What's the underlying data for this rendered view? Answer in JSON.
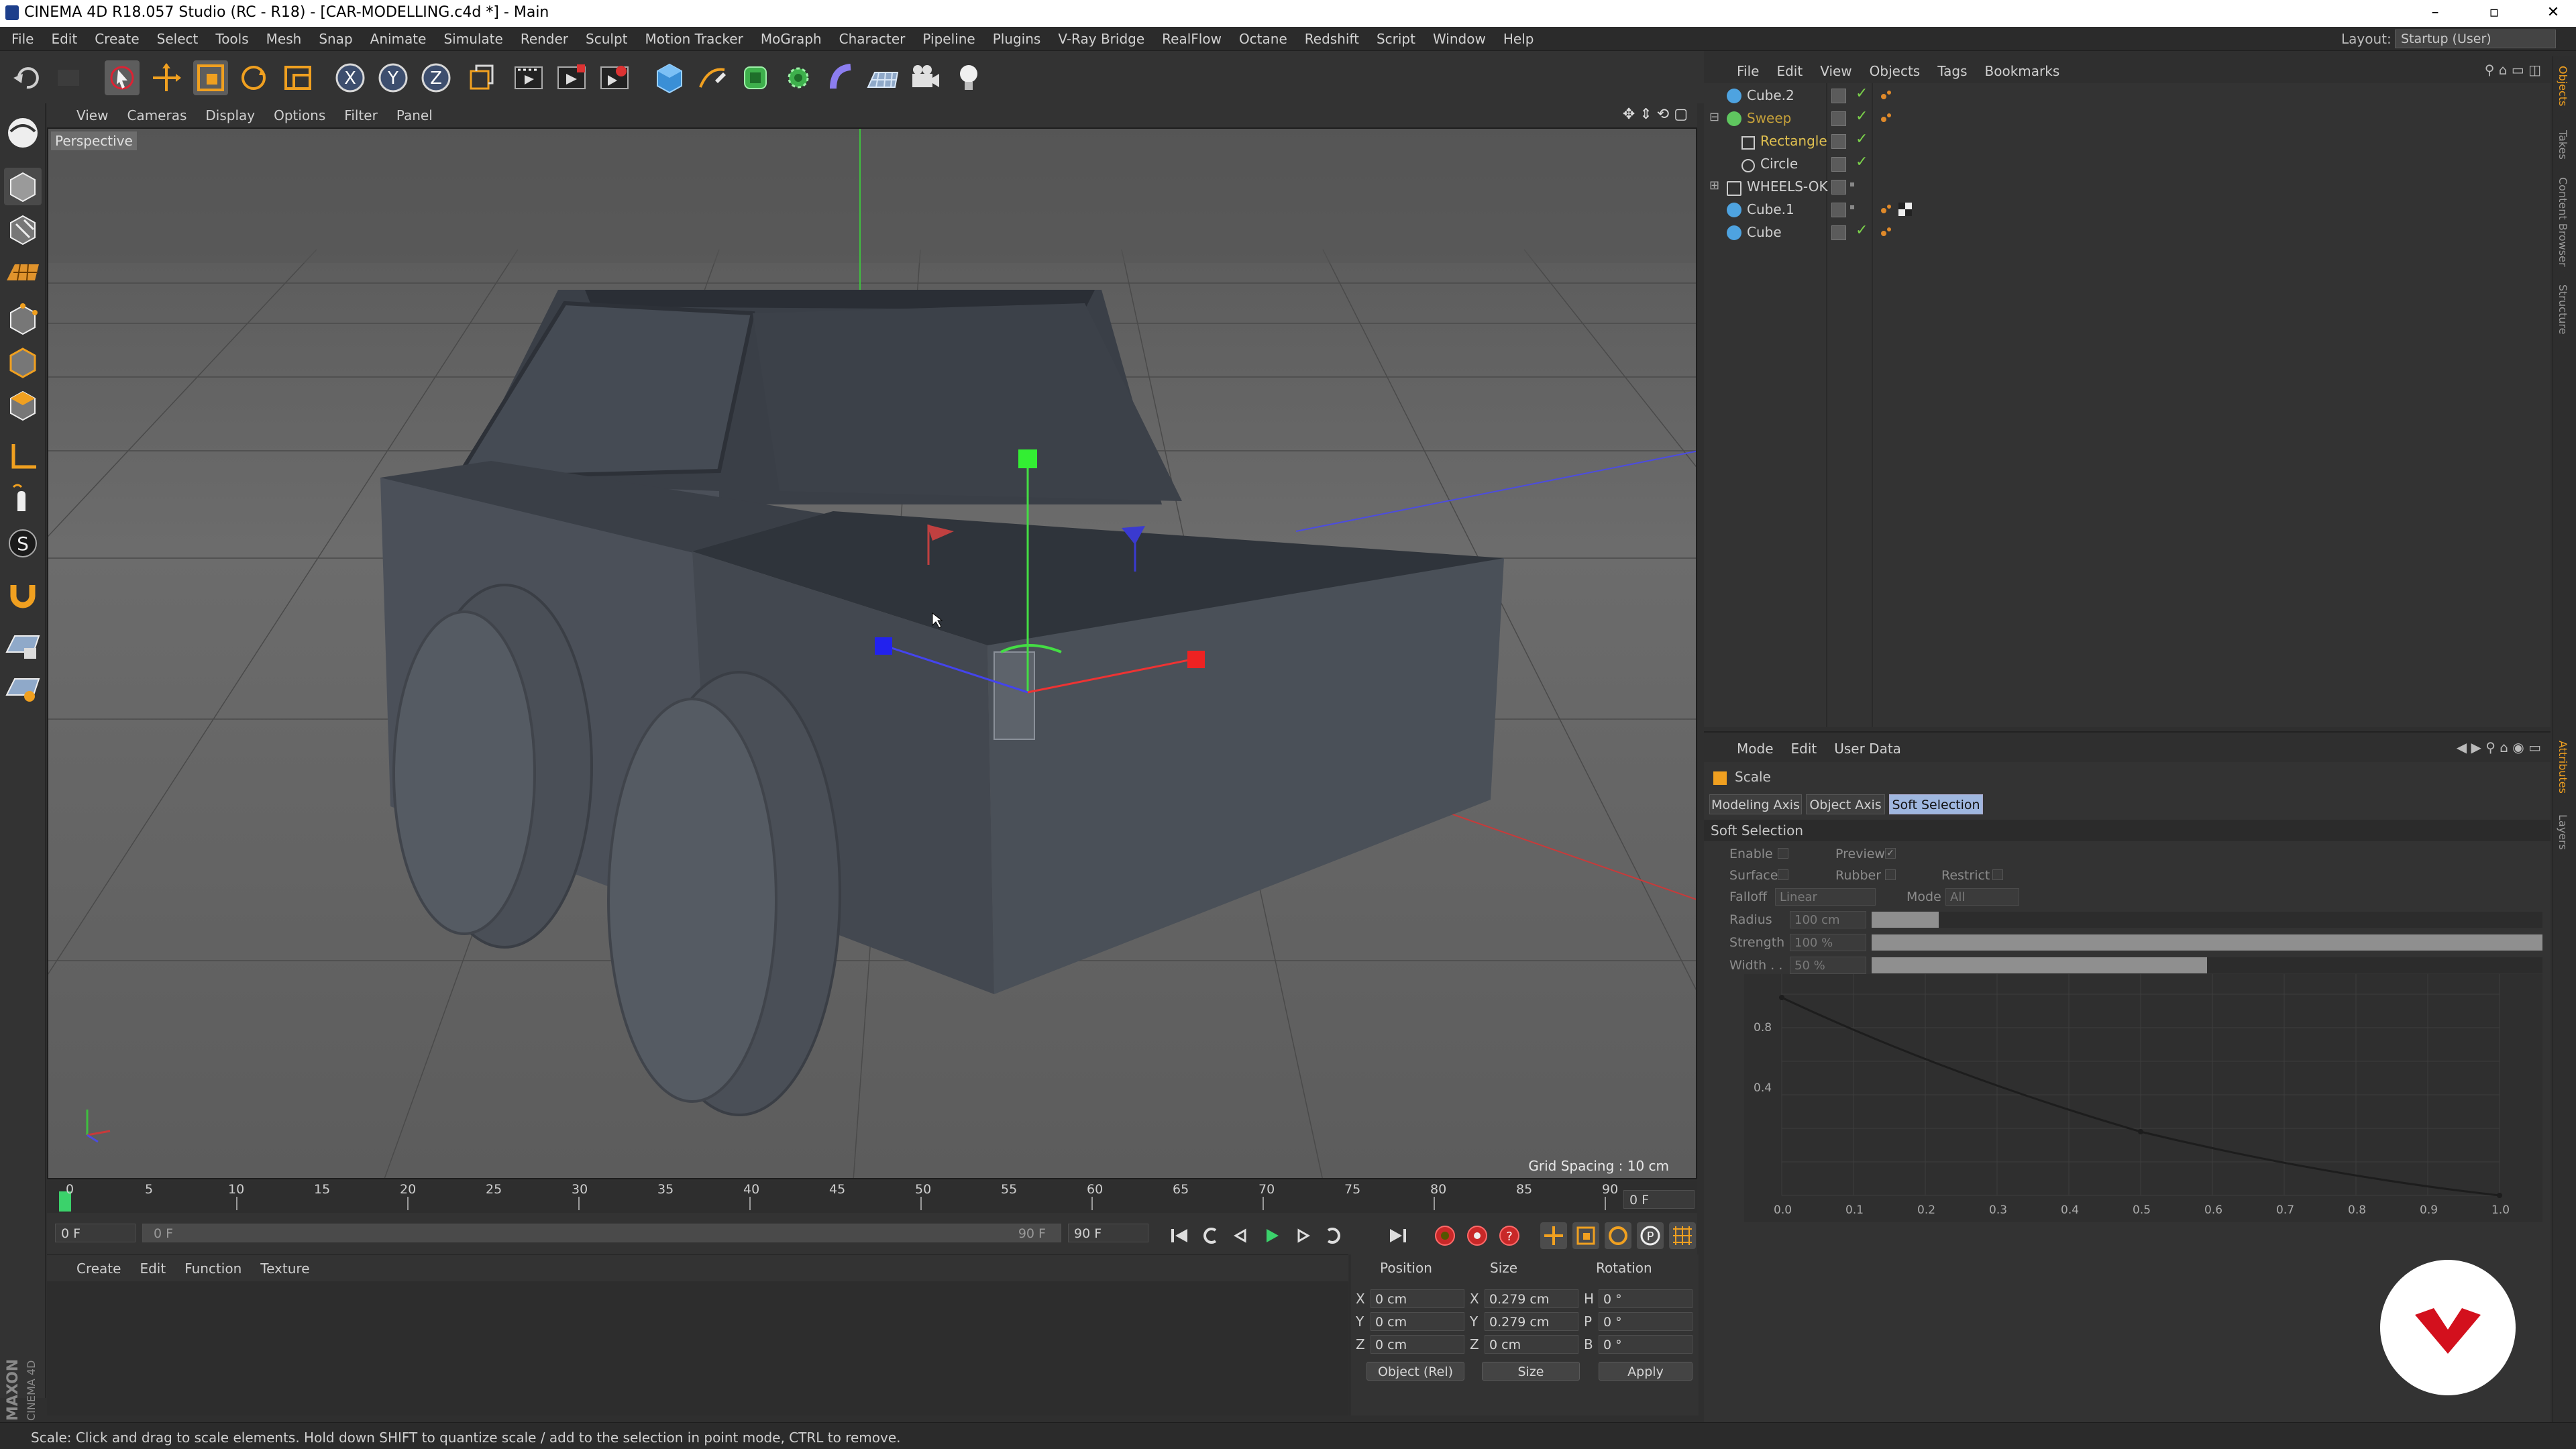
{
  "window": {
    "title": "CINEMA 4D R18.057 Studio (RC - R18) - [CAR-MODELLING.c4d *] - Main",
    "minimize": "–",
    "restore": "▫",
    "close": "✕"
  },
  "menubar": {
    "items": [
      "File",
      "Edit",
      "Create",
      "Select",
      "Tools",
      "Mesh",
      "Snap",
      "Animate",
      "Simulate",
      "Render",
      "Sculpt",
      "Motion Tracker",
      "MoGraph",
      "Character",
      "Pipeline",
      "Plugins",
      "V-Ray Bridge",
      "RealFlow",
      "Octane",
      "Redshift",
      "Script",
      "Window",
      "Help"
    ],
    "layout_label": "Layout:",
    "layout_value": "Startup (User)"
  },
  "viewport": {
    "menu": [
      "View",
      "Cameras",
      "Display",
      "Options",
      "Filter",
      "Panel"
    ],
    "camera_label": "Perspective",
    "grid_spacing": "Grid Spacing : 10 cm"
  },
  "timeline": {
    "ticks": [
      "0",
      "5",
      "10",
      "15",
      "20",
      "25",
      "30",
      "35",
      "40",
      "45",
      "50",
      "55",
      "60",
      "65",
      "70",
      "75",
      "80",
      "85",
      "90"
    ],
    "current_frame_field": "0 F",
    "start_field": "0 F",
    "range_start": "0 F",
    "range_end": "90 F",
    "end_field": "90 F"
  },
  "material_manager": {
    "menu": [
      "Create",
      "Edit",
      "Function",
      "Texture"
    ]
  },
  "coordinates": {
    "headers": {
      "position": "Position",
      "size": "Size",
      "rotation": "Rotation"
    },
    "rows": [
      {
        "axis": "X",
        "pos": "0 cm",
        "size_axis": "X",
        "size": "0.279 cm",
        "rot_axis": "H",
        "rot": "0 °"
      },
      {
        "axis": "Y",
        "pos": "0 cm",
        "size_axis": "Y",
        "size": "0.279 cm",
        "rot_axis": "P",
        "rot": "0 °"
      },
      {
        "axis": "Z",
        "pos": "0 cm",
        "size_axis": "Z",
        "size": "0 cm",
        "rot_axis": "B",
        "rot": "0 °"
      }
    ],
    "mode_select": "Object (Rel)",
    "size_select": "Size",
    "apply": "Apply"
  },
  "object_manager": {
    "menu": [
      "File",
      "Edit",
      "View",
      "Objects",
      "Tags",
      "Bookmarks"
    ],
    "objects": [
      {
        "name": "Cube.2",
        "color": "#d0d0d0",
        "icon_color": "#4ea3e0"
      },
      {
        "name": "Sweep",
        "color": "#c7a23a",
        "icon_color": "#5fc65f"
      },
      {
        "name": "Rectangle",
        "color": "#e0c050",
        "icon_color": "#d0d0d0"
      },
      {
        "name": "Circle",
        "color": "#d0d0d0",
        "icon_color": "#d0d0d0"
      },
      {
        "name": "WHEELS-OK",
        "color": "#d0d0d0",
        "icon_color": "#d0d0d0"
      },
      {
        "name": "Cube.1",
        "color": "#d0d0d0",
        "icon_color": "#4ea3e0"
      },
      {
        "name": "Cube",
        "color": "#d0d0d0",
        "icon_color": "#4ea3e0"
      }
    ]
  },
  "attributes": {
    "menu": [
      "Mode",
      "Edit",
      "User Data"
    ],
    "tool_name": "Scale",
    "tabs": [
      "Modeling Axis",
      "Object Axis",
      "Soft Selection"
    ],
    "active_tab": "Soft Selection",
    "section": "Soft Selection",
    "enable": "Enable",
    "preview": "Preview",
    "surface": "Surface",
    "rubber": "Rubber",
    "restrict": "Restrict",
    "falloff_label": "Falloff",
    "falloff_value": "Linear",
    "mode_label": "Mode",
    "mode_value": "All",
    "radius_label": "Radius",
    "radius_value": "100 cm",
    "strength_label": "Strength",
    "strength_value": "100 %",
    "width_label": "Width . .",
    "width_value": "50 %",
    "sliders": {
      "radius": 0.1,
      "strength": 1.0,
      "width": 0.5
    },
    "curve_y_ticks": [
      "0.8",
      "0.4"
    ],
    "curve_x_ticks": [
      "0.0",
      "0.1",
      "0.2",
      "0.3",
      "0.4",
      "0.5",
      "0.6",
      "0.7",
      "0.8",
      "0.9",
      "1.0"
    ]
  },
  "right_tabs": [
    "Objects",
    "Takes",
    "Content Browser",
    "Structure",
    "Attributes",
    "Layers"
  ],
  "status": "Scale: Click and drag to scale elements. Hold down SHIFT to quantize scale / add to the selection in point mode, CTRL to remove.",
  "maxon_text": "MAXON CINEMA 4D",
  "colors": {
    "accent_active_tab": "#9fb7df",
    "watermark": "#d3101d"
  }
}
